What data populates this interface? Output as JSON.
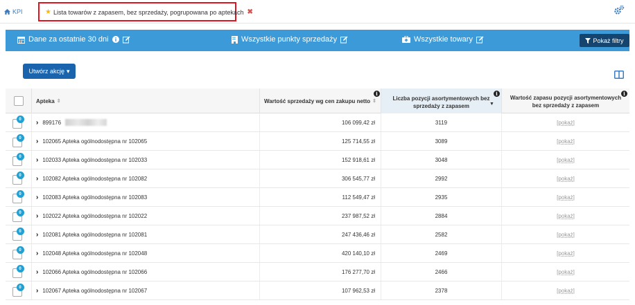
{
  "breadcrumb": {
    "home_label": "KPI"
  },
  "active_tab": {
    "label": "Lista towarów z zapasem, bez sprzedaży, pogrupowana po aptekach",
    "close_glyph": "✖"
  },
  "filters": {
    "period": "Dane za ostatnie 30 dni",
    "sales_points": "Wszystkie punkty sprzedaży",
    "products": "Wszystkie towary",
    "show_filters": "Pokaż filtry"
  },
  "actions": {
    "create_action": "Utwórz akcję"
  },
  "table": {
    "columns": [
      "",
      "Apteka",
      "Wartość sprzedaży wg cen zakupu netto",
      "Liczba pozycji asortymentowych bez sprzedaży z zapasem",
      "Wartość zapasu pozycji asortymentowych bez sprzedaży z zapasem"
    ],
    "show_label": "[pokaż]",
    "rows": [
      {
        "badge": "0",
        "pharmacy": "899176",
        "sales": "106 099,42 zł",
        "count": "3119"
      },
      {
        "badge": "0",
        "pharmacy": "102065 Apteka ogólnodostępna nr 102065",
        "sales": "125 714,55 zł",
        "count": "3089"
      },
      {
        "badge": "0",
        "pharmacy": "102033 Apteka ogólnodostępna nr 102033",
        "sales": "152 918,61 zł",
        "count": "3048"
      },
      {
        "badge": "0",
        "pharmacy": "102082 Apteka ogólnodostępna nr 102082",
        "sales": "306 545,77 zł",
        "count": "2992"
      },
      {
        "badge": "0",
        "pharmacy": "102083 Apteka ogólnodostępna nr 102083",
        "sales": "112 549,47 zł",
        "count": "2935"
      },
      {
        "badge": "0",
        "pharmacy": "102022 Apteka ogólnodostępna nr 102022",
        "sales": "237 987,52 zł",
        "count": "2884"
      },
      {
        "badge": "0",
        "pharmacy": "102081 Apteka ogólnodostępna nr 102081",
        "sales": "247 436,46 zł",
        "count": "2582"
      },
      {
        "badge": "0",
        "pharmacy": "102048 Apteka ogólnodostępna nr 102048",
        "sales": "420 140,10 zł",
        "count": "2469"
      },
      {
        "badge": "0",
        "pharmacy": "102066 Apteka ogólnodostępna nr 102066",
        "sales": "176 277,70 zł",
        "count": "2466"
      },
      {
        "badge": "0",
        "pharmacy": "102067 Apteka ogólnodostępna nr 102067",
        "sales": "107 962,53 zł",
        "count": "2378"
      }
    ]
  },
  "colors": {
    "accent": "#3d9ad8",
    "button": "#1a63ad",
    "filters_button": "#15456f",
    "highlight": "#e0141e"
  }
}
